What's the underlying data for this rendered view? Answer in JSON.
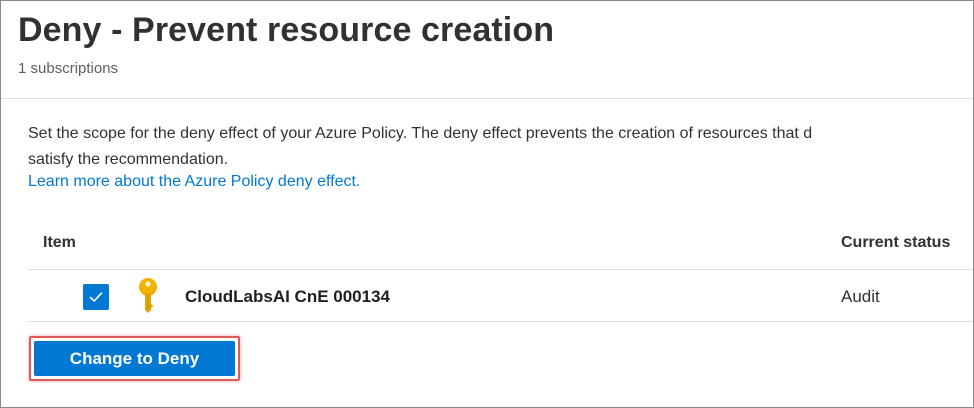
{
  "header": {
    "title": "Deny - Prevent resource creation",
    "subtitle": "1 subscriptions"
  },
  "main": {
    "description_line1": "Set the scope for the deny effect of your Azure Policy. The deny effect prevents the creation of resources that d",
    "description_line2": "satisfy the recommendation.",
    "learn_more_link": "Learn more about the Azure Policy deny effect."
  },
  "table": {
    "columns": [
      "Item",
      "Current status"
    ],
    "rows": [
      {
        "checked": true,
        "icon": "key-icon",
        "name": "CloudLabsAI CnE 000134",
        "status": "Audit"
      }
    ]
  },
  "actions": {
    "change_button_label": "Change to Deny"
  },
  "colors": {
    "accent": "#0078d4",
    "highlight_border": "#e05a5a",
    "key_icon": "#f2b300"
  }
}
